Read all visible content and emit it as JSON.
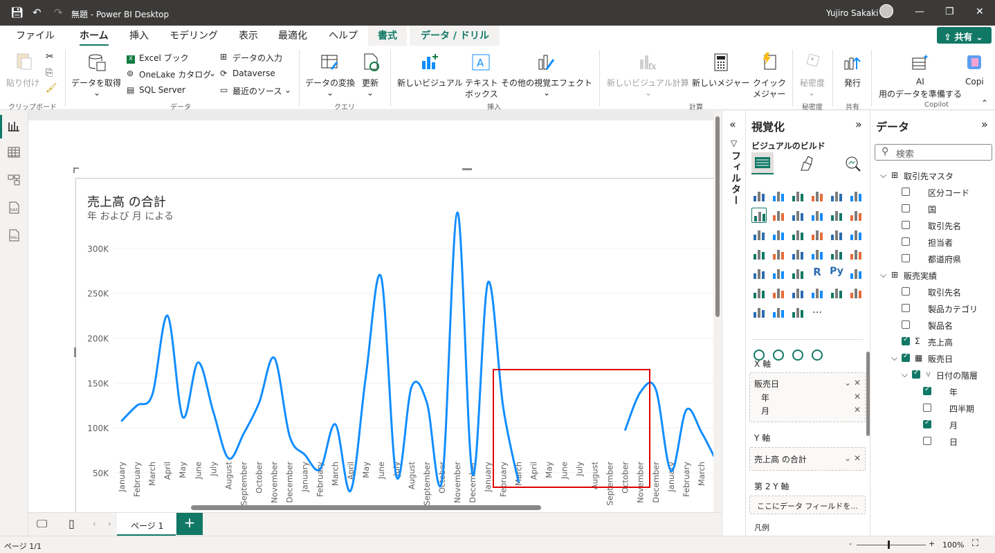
{
  "window": {
    "title": "無題 - Power BI Desktop",
    "user": "Yujiro Sakaki"
  },
  "tabs": [
    {
      "label": "ファイル"
    },
    {
      "label": "ホーム"
    },
    {
      "label": "挿入"
    },
    {
      "label": "モデリング"
    },
    {
      "label": "表示"
    },
    {
      "label": "最適化"
    },
    {
      "label": "ヘルプ"
    },
    {
      "label": "書式"
    },
    {
      "label": "データ / ドリル"
    }
  ],
  "share_label": "共有",
  "ribbon": {
    "paste": "貼り付け",
    "get_data": "データを取得",
    "excel": "Excel ブック",
    "onelake": "OneLake カタログ",
    "sql": "SQL Server",
    "enter_data": "データの入力",
    "dataverse": "Dataverse",
    "recent": "最近のソース",
    "transform": "データの変換",
    "refresh": "更新",
    "new_visual": "新しいビジュアル",
    "textbox_1": "テキスト",
    "textbox_2": "ボックス",
    "more_visuals": "その他の視覚エフェクト",
    "new_visual_calc": "新しいビジュアル計算",
    "new_measure": "新しいメジャー",
    "quick_1": "クイック",
    "quick_2": "メジャー",
    "sensitivity": "秘密度",
    "publish": "発行",
    "ai_1": "AI",
    "ai_2": "用のデータを準備する",
    "copilot": "Copi",
    "groups": {
      "clipboard": "クリップボード",
      "data": "データ",
      "query": "クエリ",
      "insert": "挿入",
      "calc": "計算",
      "sens": "秘密度",
      "share": "共有",
      "copilot": "Copilot"
    }
  },
  "visual": {
    "title": "売上高 の合計",
    "subtitle": "年 および 月 による"
  },
  "chart_data": {
    "type": "line",
    "title": "売上高 の合計",
    "subtitle": "年 および 月 による",
    "y_ticks": [
      "50K",
      "100K",
      "150K",
      "200K",
      "250K",
      "300K"
    ],
    "ylim": [
      30000,
      330000
    ],
    "x": [
      "January",
      "February",
      "March",
      "April",
      "May",
      "June",
      "July",
      "August",
      "September",
      "October",
      "November",
      "December",
      "January",
      "February",
      "March",
      "April",
      "May",
      "June",
      "July",
      "August",
      "September",
      "October",
      "November",
      "December",
      "January",
      "February",
      "March",
      "April",
      "May",
      "June",
      "July",
      "August",
      "September",
      "October",
      "November",
      "December",
      "January",
      "February",
      "March"
    ],
    "series": [
      {
        "color": "#118dff",
        "values": [
          108000,
          125000,
          137000,
          225000,
          112000,
          173000,
          118000,
          66000,
          94000,
          128000,
          178000,
          91000,
          70000,
          54000,
          104000,
          30000,
          158000,
          268000,
          46000,
          146000,
          128000,
          42000,
          340000,
          48000,
          262000,
          123000,
          40000,
          null,
          null,
          null,
          null,
          null,
          null,
          98000,
          140000,
          143000,
          52000,
          120000,
          95000,
          62000
        ]
      }
    ]
  },
  "filters_label": "フィルター",
  "viz_pane": {
    "title": "視覚化",
    "build": "ビジュアルのビルド",
    "x_axis": "X 軸",
    "x_fields": [
      "販売日",
      "年",
      "月"
    ],
    "y_axis": "Y 軸",
    "y_field": "売上高 の合計",
    "y2_axis": "第 2 Y 軸",
    "y2_placeholder": "ここにデータ フィールドを...",
    "legend": "凡例"
  },
  "data_pane": {
    "title": "データ",
    "search_placeholder": "検索",
    "tables": [
      {
        "name": "取引先マスタ",
        "fields": [
          "区分コード",
          "国",
          "取引先名",
          "担当者",
          "都道府県"
        ]
      },
      {
        "name": "販売実績",
        "fields": [
          "取引先名",
          "製品カテゴリ",
          "製品名",
          "売上高"
        ]
      }
    ],
    "date_field": "販売日",
    "hierarchy": "日付の階層",
    "levels": [
      "年",
      "四半期",
      "月",
      "日"
    ]
  },
  "page_tab": "ページ 1",
  "status": {
    "page": "ページ 1/1",
    "zoom": "100%"
  }
}
